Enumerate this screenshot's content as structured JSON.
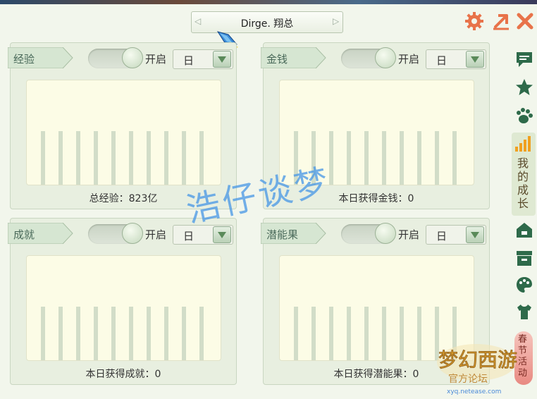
{
  "title": "Dirge. 翔总",
  "watermark": "浩仔谈梦",
  "panels": [
    {
      "tag": "经验",
      "toggle_label": "开启",
      "select_value": "日",
      "caption": "总经验：823亿"
    },
    {
      "tag": "金钱",
      "toggle_label": "开启",
      "select_value": "日",
      "caption": "本日获得金钱：0"
    },
    {
      "tag": "成就",
      "toggle_label": "开启",
      "select_value": "日",
      "caption": "本日获得成就：0"
    },
    {
      "tag": "潜能果",
      "toggle_label": "开启",
      "select_value": "日",
      "caption": "本日获得潜能果：0"
    }
  ],
  "sidebar": {
    "active_tab_label": "我的成长",
    "festival_tab_label": "春节活动"
  },
  "logo": {
    "text": "梦幻西游",
    "sub": "官方论坛",
    "url": "xyq.netease.com"
  },
  "colors": {
    "accent": "#e8734a",
    "panel_bg": "#e8efe0",
    "chart_bg": "#fcfce6",
    "bar": "#d2ddc8"
  }
}
